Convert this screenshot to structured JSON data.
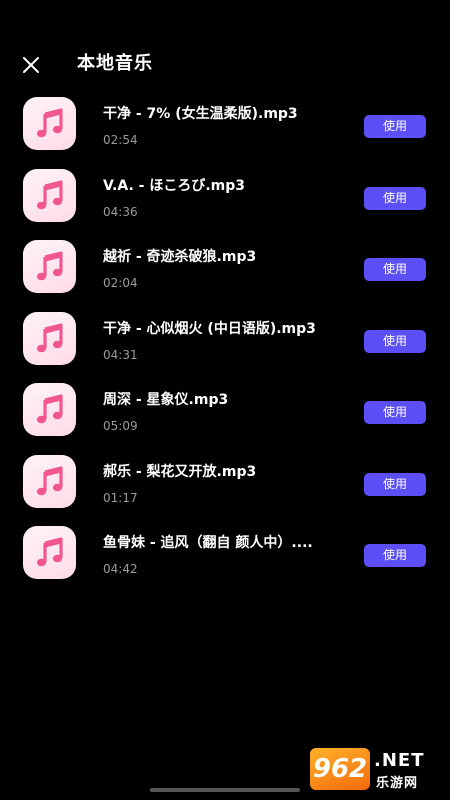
{
  "header": {
    "title": "本地音乐",
    "close_icon": "close-icon"
  },
  "songs": [
    {
      "title": "干净 - 7% (女生温柔版).mp3",
      "duration": "02:54",
      "action": "使用"
    },
    {
      "title": "V.A. - ほころび.mp3",
      "duration": "04:36",
      "action": "使用"
    },
    {
      "title": "越祈 - 奇迹杀破狼.mp3",
      "duration": "02:04",
      "action": "使用"
    },
    {
      "title": "干净 - 心似烟火 (中日语版).mp3",
      "duration": "04:31",
      "action": "使用"
    },
    {
      "title": "周深 - 星象仪.mp3",
      "duration": "05:09",
      "action": "使用"
    },
    {
      "title": "郝乐 - 梨花又开放.mp3",
      "duration": "01:17",
      "action": "使用"
    },
    {
      "title": "鱼骨妹 - 追风（翻自 颜人中）....",
      "duration": "04:42",
      "action": "使用"
    }
  ],
  "thumb_icon": "music-note-icon",
  "colors": {
    "background": "#000000",
    "accent": "#5b4ff5",
    "thumb_bg": "#ffdbe8",
    "note": "#f0578f",
    "secondary_text": "#9a9a9a"
  },
  "watermark": {
    "logo": "962",
    "net": ".NET",
    "cn": "乐游网"
  }
}
